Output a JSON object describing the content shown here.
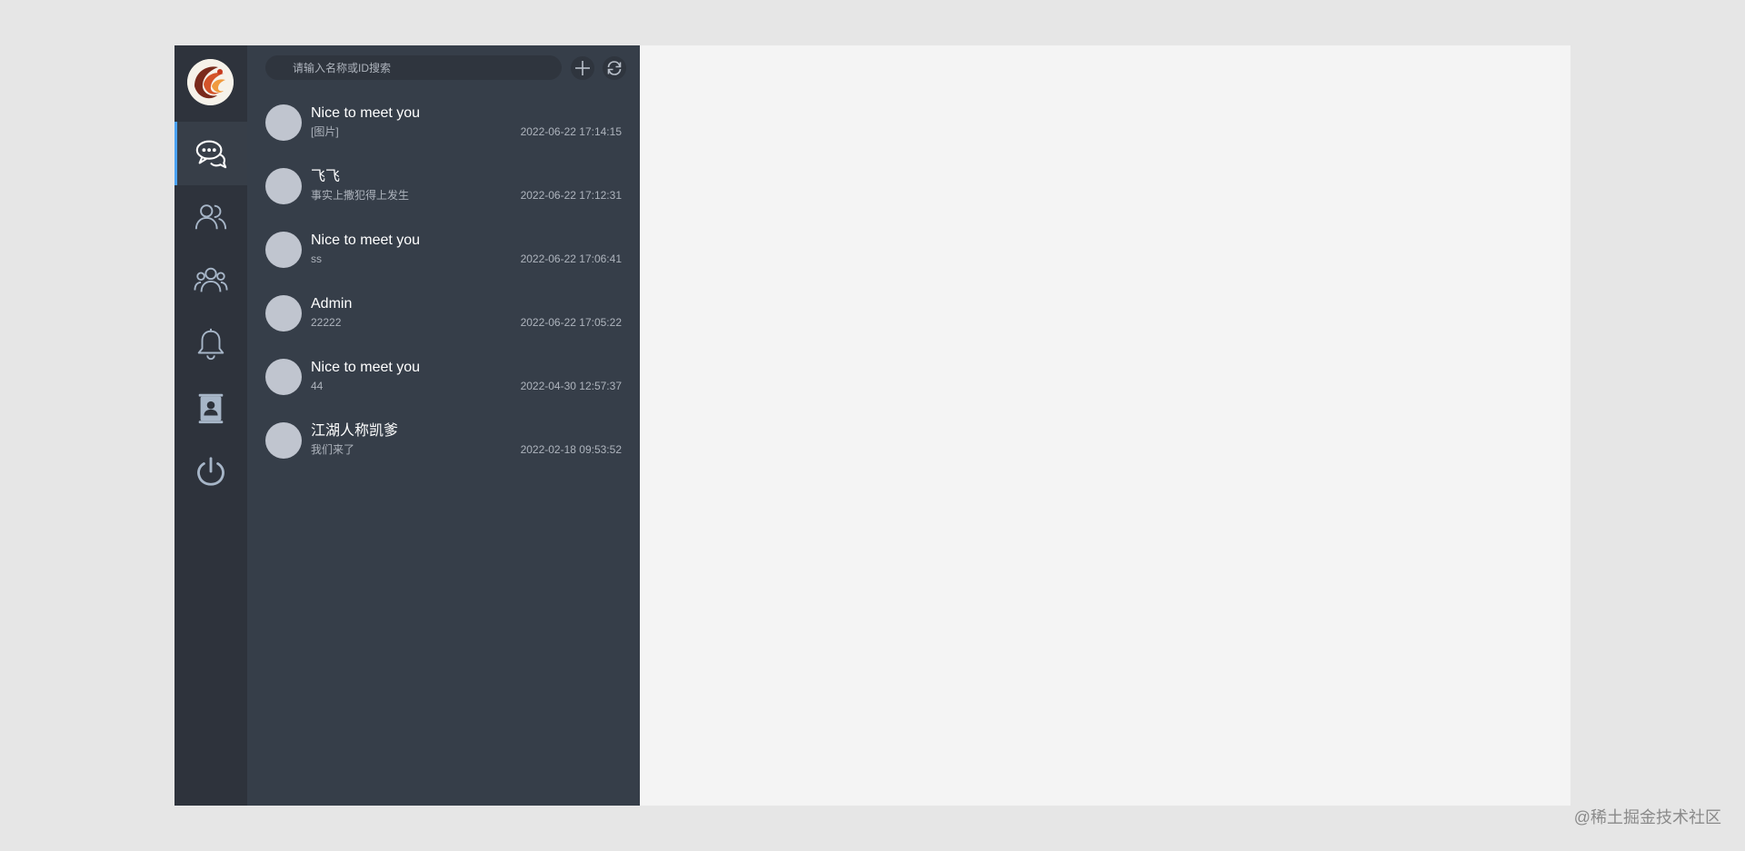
{
  "search": {
    "placeholder": "请输入名称或ID搜索"
  },
  "nav": {
    "active": "messages",
    "items": [
      {
        "key": "messages",
        "icon": "chat-bubbles-icon"
      },
      {
        "key": "friends",
        "icon": "users-icon"
      },
      {
        "key": "groups",
        "icon": "group-icon"
      },
      {
        "key": "notifications",
        "icon": "bell-icon"
      },
      {
        "key": "profile",
        "icon": "contact-card-icon"
      },
      {
        "key": "logout",
        "icon": "power-icon"
      }
    ]
  },
  "sessions": [
    {
      "name": "Nice to meet you",
      "last_message": "[图片]",
      "time": "2022-06-22 17:14:15"
    },
    {
      "name": "飞飞",
      "last_message": "事实上撒犯得上发生",
      "time": "2022-06-22 17:12:31"
    },
    {
      "name": "Nice to meet you",
      "last_message": "ss",
      "time": "2022-06-22 17:06:41"
    },
    {
      "name": "Admin",
      "last_message": "22222",
      "time": "2022-06-22 17:05:22"
    },
    {
      "name": "Nice to meet you",
      "last_message": "44",
      "time": "2022-04-30 12:57:37"
    },
    {
      "name": "江湖人称凯爹",
      "last_message": "我们来了",
      "time": "2022-02-18 09:53:52"
    }
  ],
  "watermark": "@稀土掘金技术社区",
  "colors": {
    "rail_bg": "#2e333c",
    "list_bg": "#363e49",
    "accent": "#4aa2f4",
    "main_bg": "#f4f4f4",
    "page_bg": "#e6e6e6"
  }
}
